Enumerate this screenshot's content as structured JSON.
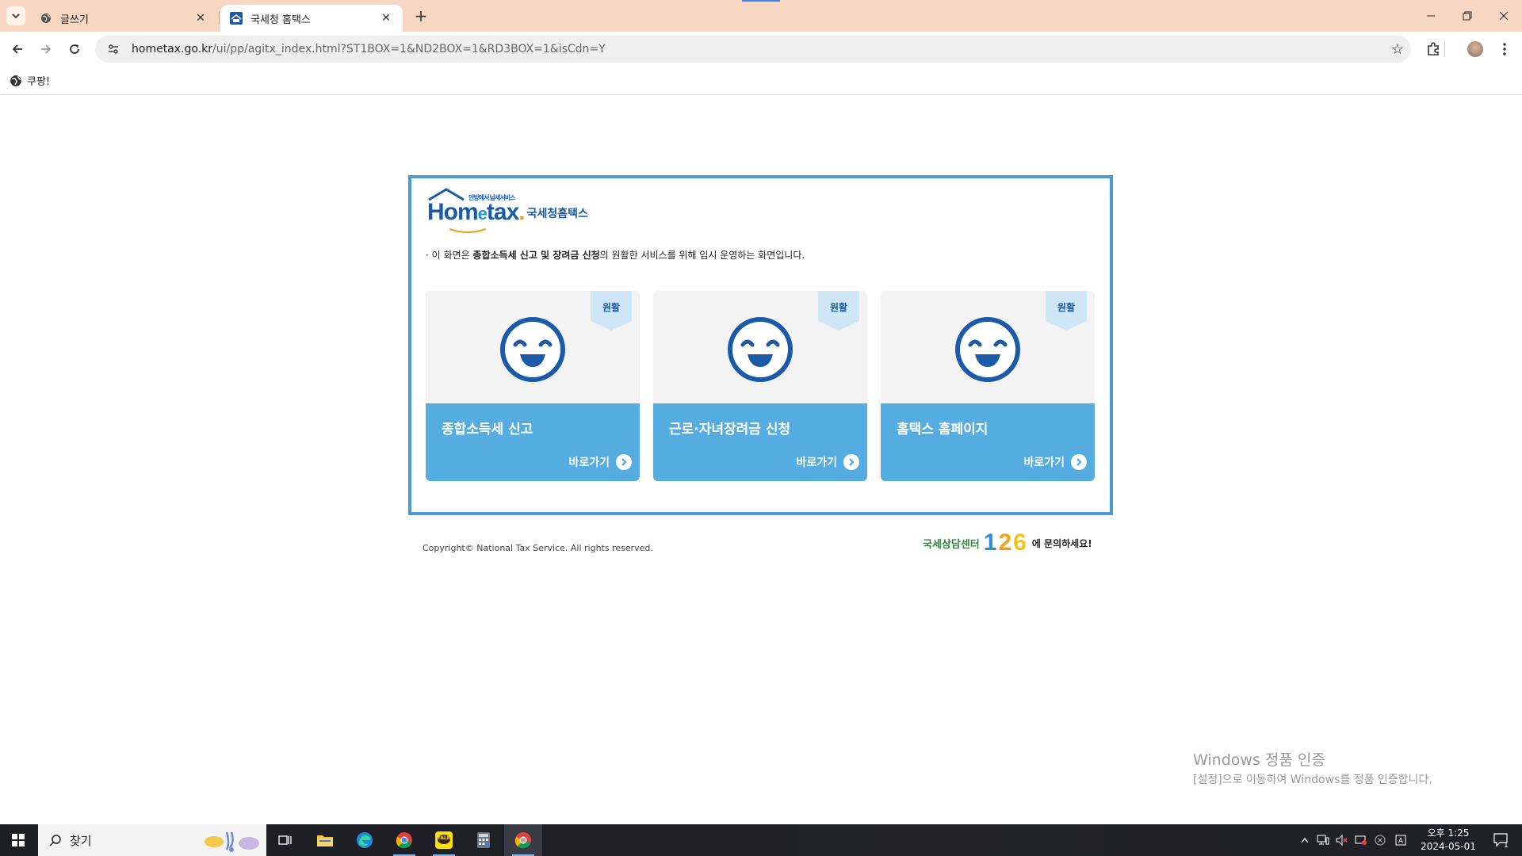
{
  "browser": {
    "tabs": [
      {
        "title": "글쓰기",
        "icon": "globe-icon"
      },
      {
        "title": "국세청 홈택스",
        "icon": "hometax-favicon"
      }
    ],
    "new_tab_label": "+",
    "url_host": "hometax.go.kr",
    "url_path": "/ui/pp/agitx_index.html?ST1BOX=1&ND2BOX=1&RD3BOX=1&isCdn=Y",
    "bookmark": "쿠팡!"
  },
  "page": {
    "logo_word_a": "Hom",
    "logo_word_e": "e",
    "logo_word_b": "tax",
    "logo_dot": ".",
    "logo_tagline": "안방에서 납세서비스",
    "logo_korean": "국세청홈택스",
    "notice_prefix": "· 이 화면은 ",
    "notice_bold": "종합소득세 신고 및 장려금 신청",
    "notice_suffix": "의 원활한 서비스를 위해 임시 운영하는 화면입니다.",
    "cards": [
      {
        "status": "원활",
        "title": "종합소득세 신고",
        "link": "바로가기"
      },
      {
        "status": "원활",
        "title": "근로·자녀장려금 신청",
        "link": "바로가기"
      },
      {
        "status": "원활",
        "title": "홈택스 홈페이지",
        "link": "바로가기"
      }
    ],
    "copyright": "Copyright© National Tax Service. All rights reserved.",
    "callcenter_hand": "국세상담센터",
    "callcenter_num": [
      "1",
      "2",
      "6"
    ],
    "callcenter_ask": "에 문의하세요!"
  },
  "watermark": {
    "line1": "Windows 정품 인증",
    "line2": "[설정]으로 이동하여 Windows를 정품 인증합니다."
  },
  "taskbar": {
    "search_placeholder": "찾기",
    "clock_ampm_time": "오후 1:25",
    "clock_date": "2024-05-01",
    "notification_count": "1",
    "kakao_label": "TALK"
  },
  "colors": {
    "frame_border": "#4a9ad4",
    "card_bottom": "#55ace0",
    "brand_blue": "#1b5aa8",
    "tabbar": "#f7d7c4"
  }
}
